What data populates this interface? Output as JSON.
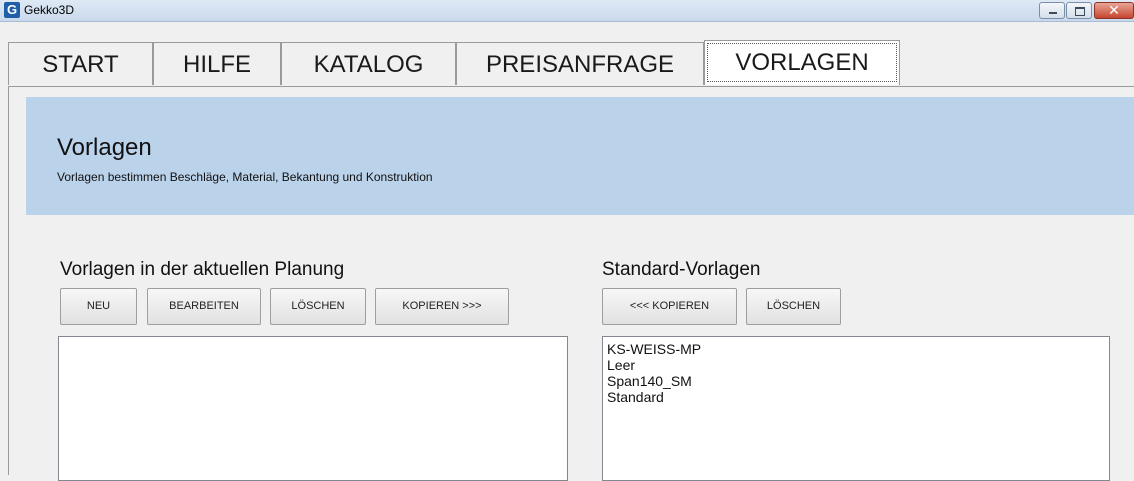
{
  "window": {
    "title": "Gekko3D",
    "app_icon_letter": "G"
  },
  "tabs": [
    {
      "label": "START"
    },
    {
      "label": "HILFE"
    },
    {
      "label": "KATALOG"
    },
    {
      "label": "PREISANFRAGE"
    },
    {
      "label": "VORLAGEN",
      "active": true
    }
  ],
  "banner": {
    "title": "Vorlagen",
    "subtitle": "Vorlagen bestimmen Beschläge, Material, Bekantung und Konstruktion",
    "background_color": "#bad2ea"
  },
  "current_templates": {
    "title": "Vorlagen in der aktuellen Planung",
    "buttons": {
      "new": "NEU",
      "edit": "BEARBEITEN",
      "delete": "LÖSCHEN",
      "copy_right": "KOPIEREN >>>"
    },
    "items": []
  },
  "standard_templates": {
    "title": "Standard-Vorlagen",
    "buttons": {
      "copy_left": "<<< KOPIEREN",
      "delete": "LÖSCHEN"
    },
    "items": [
      "KS-WEISS-MP",
      "Leer",
      "Span140_SM",
      "Standard"
    ]
  },
  "icons": [
    "app-icon",
    "minimize-icon",
    "maximize-icon",
    "close-icon"
  ]
}
